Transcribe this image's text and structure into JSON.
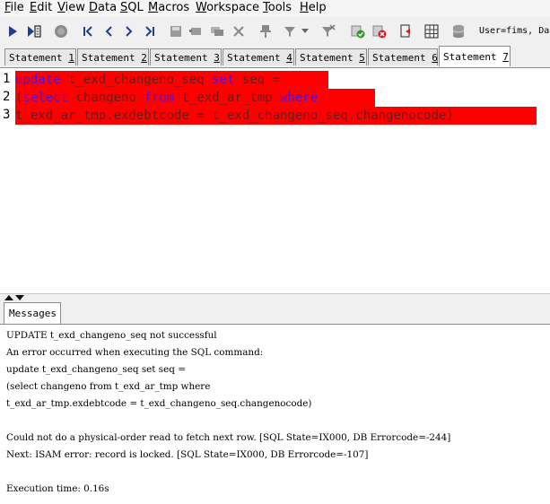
{
  "menu": {
    "items": [
      {
        "label": "File",
        "ul": "F",
        "rest": "ile"
      },
      {
        "label": "Edit",
        "ul": "E",
        "rest": "dit"
      },
      {
        "label": "View",
        "ul": "V",
        "rest": "iew"
      },
      {
        "label": "Data",
        "ul": "D",
        "rest": "ata"
      },
      {
        "label": "SQL",
        "ul": "S",
        "rest": "QL"
      },
      {
        "label": "Macros",
        "ul": "M",
        "rest": "acros"
      },
      {
        "label": "Workspace",
        "ul": "W",
        "rest": "orkspace"
      },
      {
        "label": "Tools",
        "ul": "T",
        "rest": "ools"
      },
      {
        "label": "Help",
        "ul": "H",
        "rest": "elp"
      }
    ]
  },
  "toolbar": {
    "user_info": "User=fims, Da"
  },
  "tabs": [
    {
      "prefix": "Statement ",
      "num": "1"
    },
    {
      "prefix": "Statement ",
      "num": "2"
    },
    {
      "prefix": "Statement ",
      "num": "3"
    },
    {
      "prefix": "Statement ",
      "num": "4"
    },
    {
      "prefix": "Statement ",
      "num": "5"
    },
    {
      "prefix": "Statement ",
      "num": "6"
    },
    {
      "prefix": "Statement ",
      "num": "7"
    }
  ],
  "editor": {
    "line_numbers": [
      "1",
      "2",
      "3"
    ],
    "lines": [
      [
        {
          "t": "update",
          "kw": true
        },
        {
          "t": " t_exd_changeno_seq ",
          "kw": false
        },
        {
          "t": "set",
          "kw": true
        },
        {
          "t": " seq =",
          "kw": false
        }
      ],
      [
        {
          "t": "(",
          "kw": false
        },
        {
          "t": "select",
          "kw": true
        },
        {
          "t": " changeno ",
          "kw": false
        },
        {
          "t": "from",
          "kw": true
        },
        {
          "t": " t_exd_ar_tmp ",
          "kw": false
        },
        {
          "t": "where",
          "kw": true
        }
      ],
      [
        {
          "t": "t_exd_ar_tmp.exdebtcode = t_exd_changeno_seq.changenocode)",
          "kw": false
        }
      ]
    ]
  },
  "messages": {
    "tab_label": "Messages",
    "lines": [
      "UPDATE t_exd_changeno_seq not successful",
      "An error occurred when executing the SQL command:",
      "update t_exd_changeno_seq set seq =",
      "(select changeno from t_exd_ar_tmp where",
      "t_exd_ar_tmp.exdebtcode = t_exd_changeno_seq.changenocode)",
      "",
      "Could not do a physical-order read to fetch next row. [SQL State=IX000, DB Errorcode=-244]",
      "Next: ISAM error: record is locked. [SQL State=IX000, DB Errorcode=-107]",
      "",
      "Execution time: 0.16s"
    ]
  },
  "colors": {
    "selection": "#ff0000",
    "keyword": "#5a0fd8",
    "identifier": "#6a1a1a"
  }
}
